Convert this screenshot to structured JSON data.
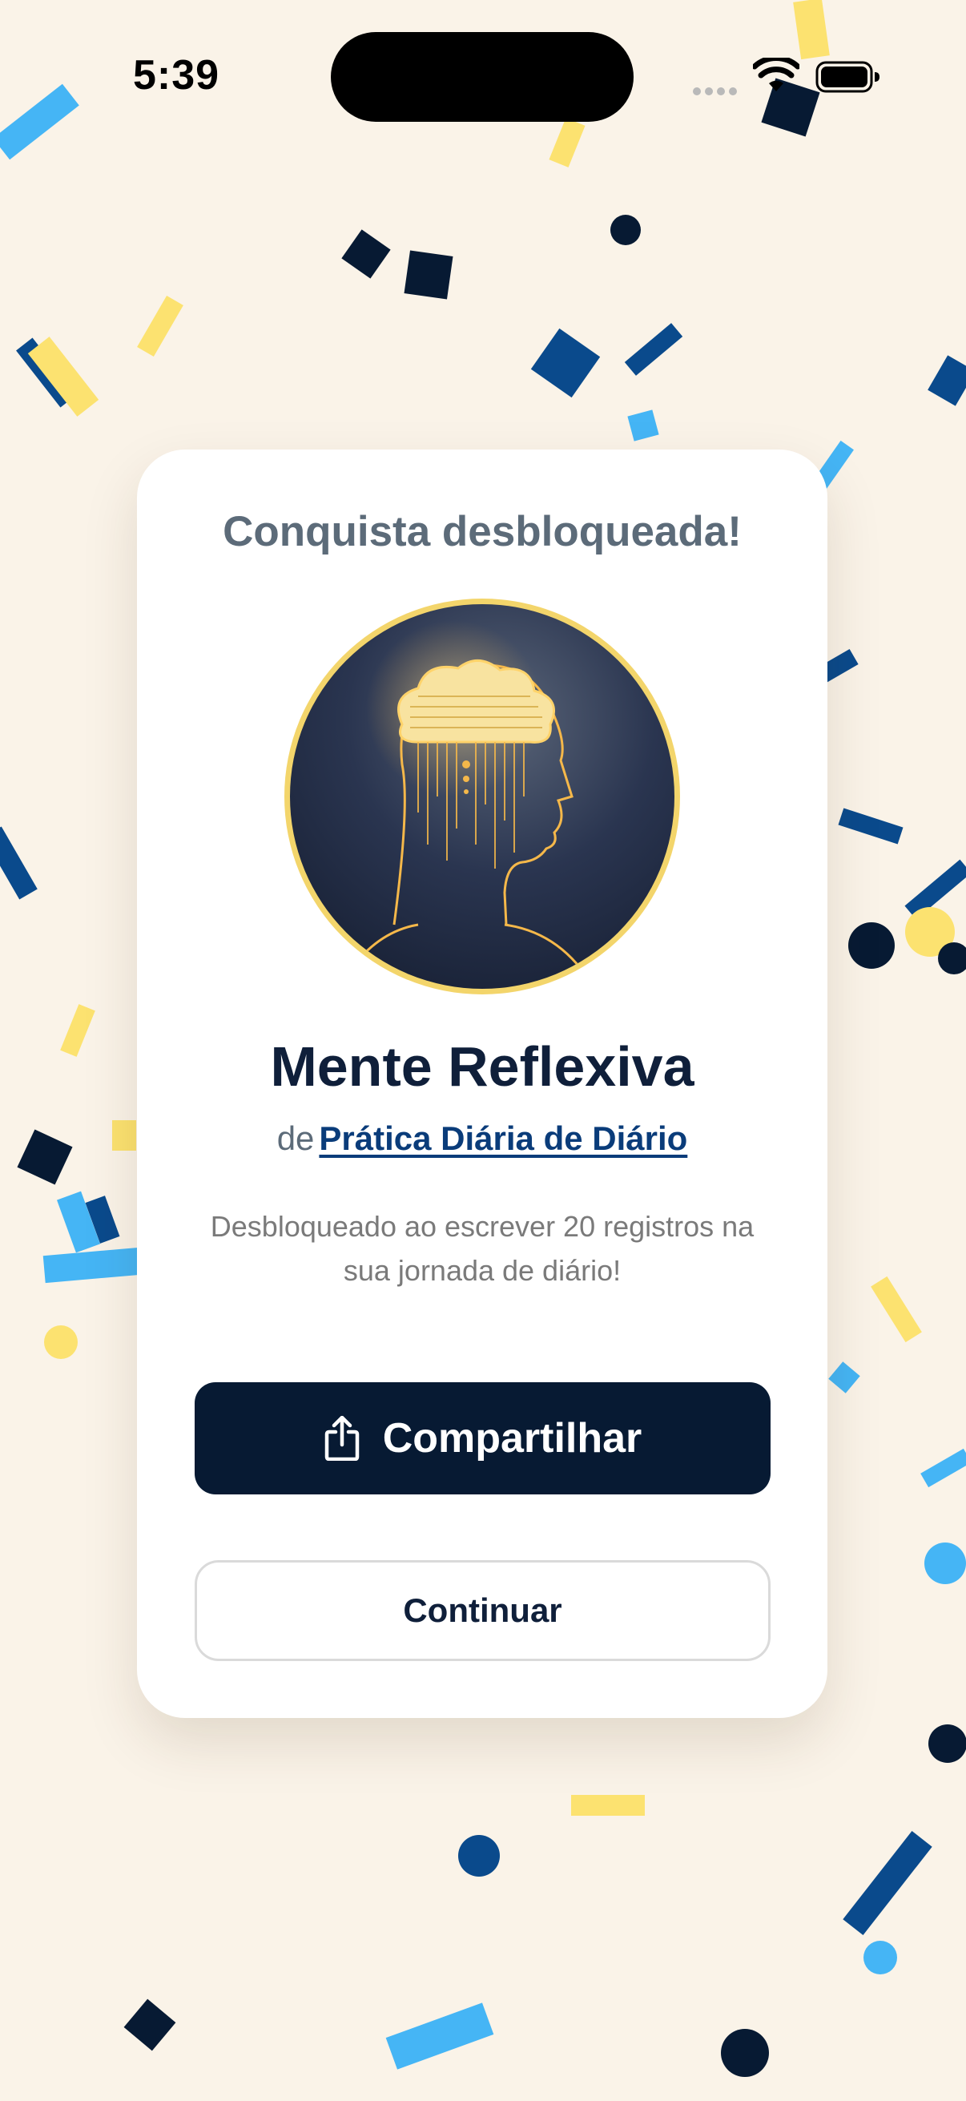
{
  "status_bar": {
    "time": "5:39",
    "icons": [
      "cellular-dots-icon",
      "wifi-icon",
      "battery-icon"
    ]
  },
  "card": {
    "heading": "Conquista desbloqueada!",
    "badge_image": "reflective-mind-badge",
    "title": "Mente Reflexiva",
    "source_prefix": "de",
    "source_link": "Prática Diária de Diário",
    "description": "Desbloqueado ao escrever 20 registros na sua jornada de diário!",
    "share_label": "Compartilhar",
    "continue_label": "Continuar"
  },
  "colors": {
    "background": "#FAF3E8",
    "navy": "#071A33",
    "blue": "#0A4A8C",
    "sky": "#45B5F5",
    "yellow": "#FCE270",
    "heading_gray": "#5C6B79"
  }
}
